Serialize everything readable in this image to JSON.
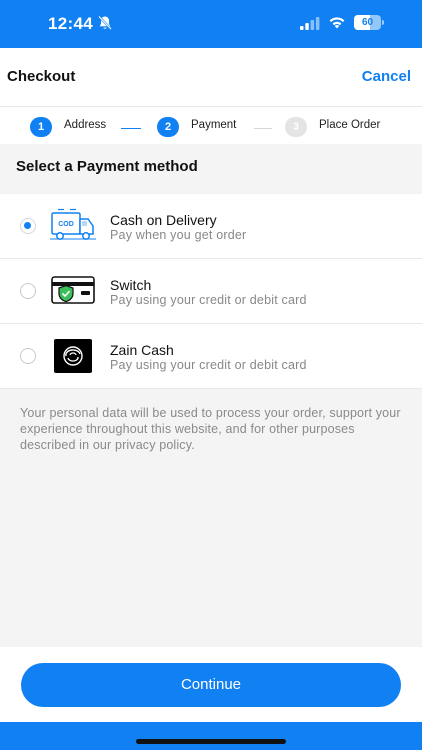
{
  "status_bar": {
    "time": "12:44",
    "battery_text": "60",
    "battery_level": 0.6,
    "color": "#1180f2"
  },
  "nav": {
    "title": "Checkout",
    "cancel_label": "Cancel"
  },
  "stepper": {
    "steps": [
      {
        "number": "1",
        "label": "Address",
        "state": "active"
      },
      {
        "number": "2",
        "label": "Payment",
        "state": "active"
      },
      {
        "number": "3",
        "label": "Place Order",
        "state": "inactive"
      }
    ]
  },
  "section": {
    "title": "Select a Payment method"
  },
  "payment_methods": [
    {
      "title": "Cash on Delivery",
      "subtitle": "Pay when you get order",
      "selected": true,
      "icon": "cod-truck-icon"
    },
    {
      "title": "Switch",
      "subtitle": "Pay using your credit or debit card",
      "selected": false,
      "icon": "credit-card-shield-icon"
    },
    {
      "title": "Zain Cash",
      "subtitle": "Pay using your credit or debit card",
      "selected": false,
      "icon": "zain-cash-logo-icon"
    }
  ],
  "privacy": {
    "text": "Your personal data will be used to process your order, support your experience throughout this website, and for other purposes described in our privacy policy."
  },
  "footer": {
    "continue_label": "Continue"
  },
  "colors": {
    "accent": "#1180f2",
    "background_gray": "#f4f4f4"
  }
}
